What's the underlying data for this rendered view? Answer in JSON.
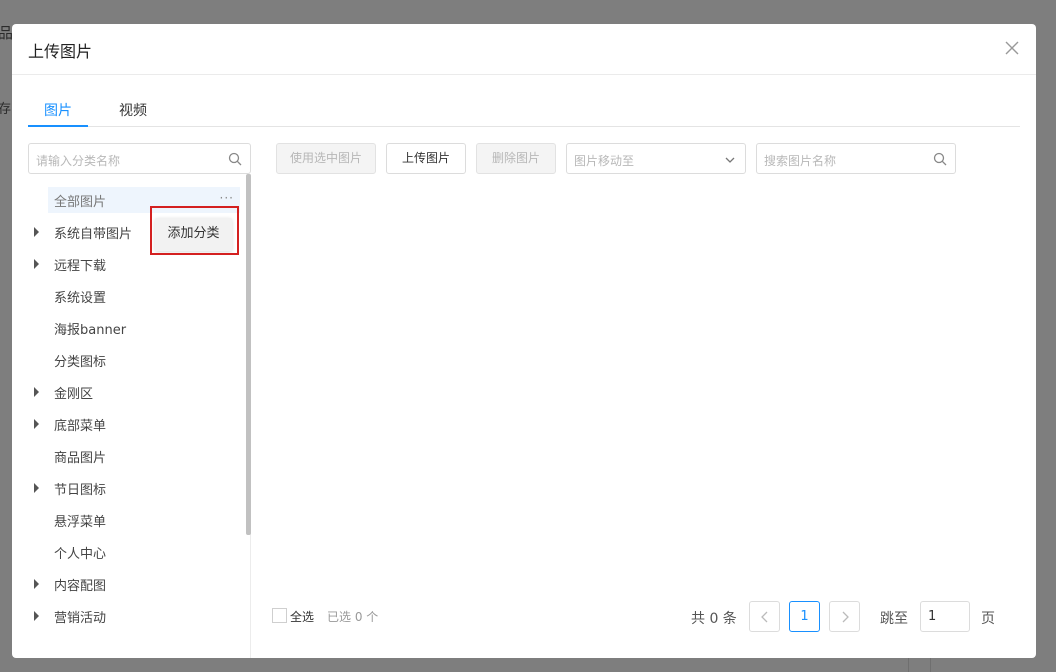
{
  "background": {
    "frag_top": "品",
    "frag_mid": "存"
  },
  "modal": {
    "title": "上传图片",
    "tabs": [
      {
        "label": "图片",
        "active": true
      },
      {
        "label": "视频",
        "active": false
      }
    ],
    "category_search": {
      "placeholder": "请输入分类名称"
    },
    "toolbar": {
      "use_selected": "使用选中图片",
      "upload": "上传图片",
      "delete": "删除图片",
      "move_to": "图片移动至",
      "image_search_placeholder": "搜索图片名称"
    },
    "tree": {
      "items": [
        {
          "label": "全部图片",
          "has_children": false,
          "selected": true
        },
        {
          "label": "系统自带图片",
          "has_children": true
        },
        {
          "label": "远程下载",
          "has_children": true
        },
        {
          "label": "系统设置",
          "has_children": false
        },
        {
          "label": "海报banner",
          "has_children": false
        },
        {
          "label": "分类图标",
          "has_children": false
        },
        {
          "label": "金刚区",
          "has_children": true
        },
        {
          "label": "底部菜单",
          "has_children": true
        },
        {
          "label": "商品图片",
          "has_children": false
        },
        {
          "label": "节日图标",
          "has_children": true
        },
        {
          "label": "悬浮菜单",
          "has_children": false
        },
        {
          "label": "个人中心",
          "has_children": false
        },
        {
          "label": "内容配图",
          "has_children": true
        },
        {
          "label": "营销活动",
          "has_children": true
        }
      ],
      "more_dots": "···",
      "popup_label": "添加分类"
    },
    "footer": {
      "select_all": "全选",
      "selected_count": "已选 0 个",
      "total": "共 0 条",
      "current_page": "1",
      "jump_to": "跳至",
      "jump_value": "1",
      "page_unit": "页"
    }
  },
  "colors": {
    "accent": "#1890ff",
    "highlight_border": "#d42020",
    "overlay": "#7e7e7e"
  }
}
